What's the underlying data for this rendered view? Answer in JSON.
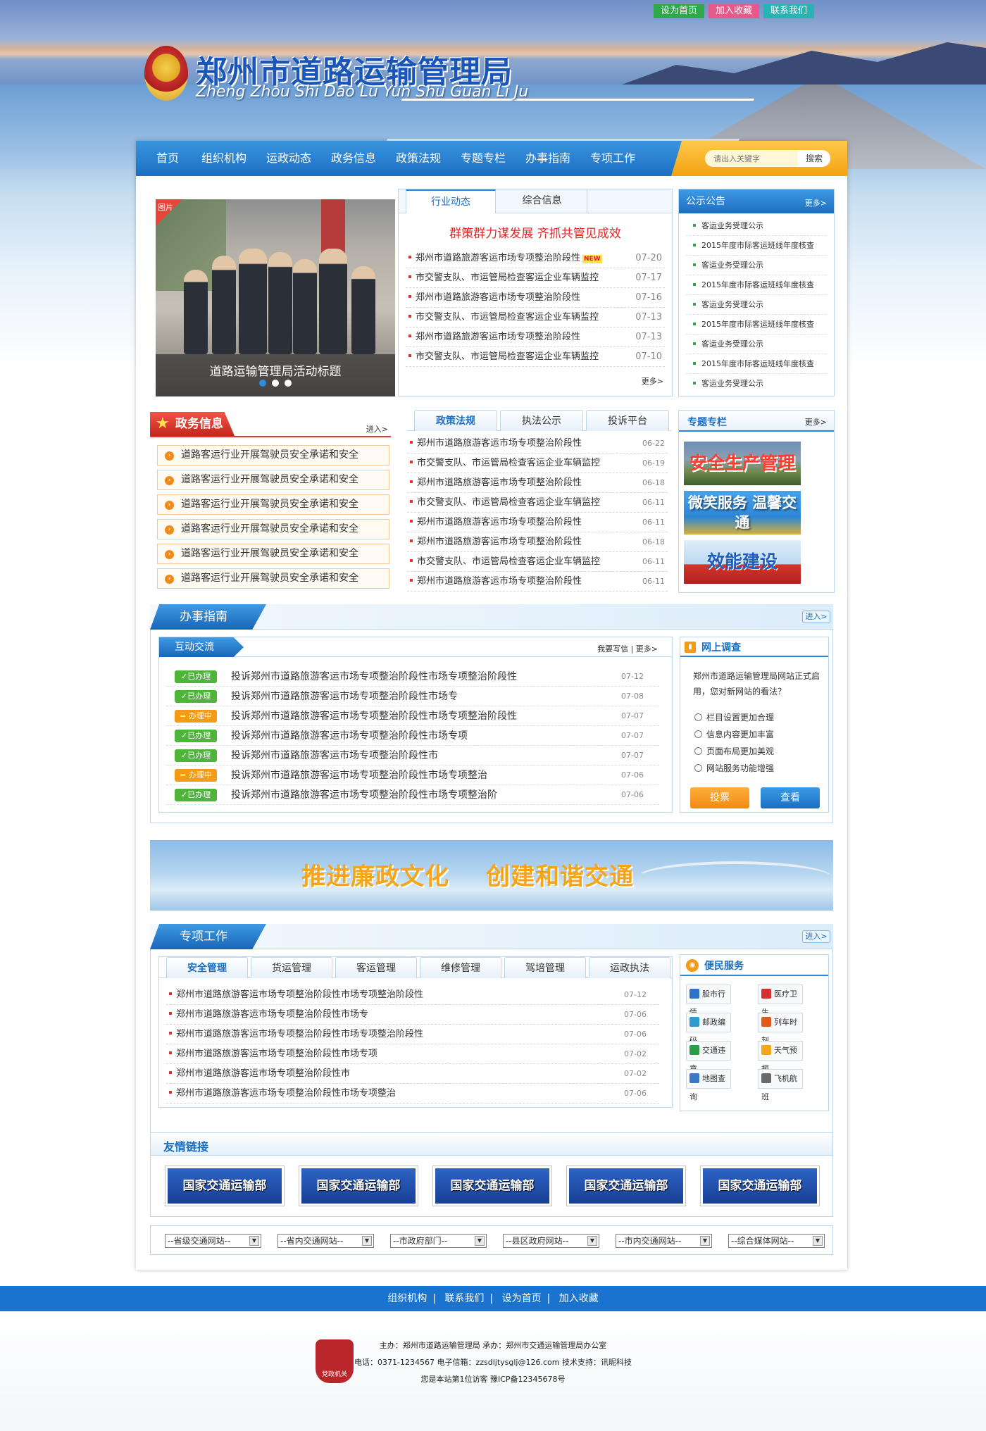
{
  "top_links": [
    "设为首页",
    "加入收藏",
    "联系我们"
  ],
  "site": {
    "title": "郑州市道路运输管理局",
    "subtitle": "Zheng Zhou Shi Dao Lu Yun Shu Guan Li Ju"
  },
  "nav": [
    "首页",
    "组织机构",
    "运政动态",
    "政务信息",
    "政策法规",
    "专题专栏",
    "办事指南",
    "专项工作"
  ],
  "search": {
    "placeholder": "请出入关键字",
    "button": "搜索"
  },
  "slider": {
    "badge": "图片",
    "caption": "道路运输管理局活动标题"
  },
  "news": {
    "tabs": [
      "行业动态",
      "综合信息"
    ],
    "headline": "群策群力谋发展 齐抓共管见成效",
    "new_tag": "NEW",
    "items": [
      {
        "title": "郑州市道路旅游客运市场专项整治阶段性",
        "date": "07-20"
      },
      {
        "title": "市交警支队、市运管局检查客运企业车辆监控",
        "date": "07-17"
      },
      {
        "title": "郑州市道路旅游客运市场专项整治阶段性",
        "date": "07-16"
      },
      {
        "title": "市交警支队、市运管局检查客运企业车辆监控",
        "date": "07-13"
      },
      {
        "title": "郑州市道路旅游客运市场专项整治阶段性",
        "date": "07-13"
      },
      {
        "title": "市交警支队、市运管局检查客运企业车辆监控",
        "date": "07-10"
      }
    ],
    "more": "更多>"
  },
  "notice": {
    "title": "公示公告",
    "more": "更多>",
    "items": [
      "客运业务受理公示",
      "2015年度市际客运班线年度核查",
      "客运业务受理公示",
      "2015年度市际客运班线年度核查",
      "客运业务受理公示",
      "2015年度市际客运班线年度核查",
      "客运业务受理公示",
      "2015年度市际客运班线年度核查",
      "客运业务受理公示"
    ]
  },
  "gov": {
    "title": "政务信息",
    "enter": "进入>",
    "items": [
      "道路客运行业开展驾驶员安全承诺和安全",
      "道路客运行业开展驾驶员安全承诺和安全",
      "道路客运行业开展驾驶员安全承诺和安全",
      "道路客运行业开展驾驶员安全承诺和安全",
      "道路客运行业开展驾驶员安全承诺和安全",
      "道路客运行业开展驾驶员安全承诺和安全"
    ]
  },
  "policy": {
    "tabs": [
      "政策法规",
      "执法公示",
      "投诉平台"
    ],
    "items": [
      {
        "title": "郑州市道路旅游客运市场专项整治阶段性",
        "date": "06-22"
      },
      {
        "title": "市交警支队、市运管局检查客运企业车辆监控",
        "date": "06-19"
      },
      {
        "title": "郑州市道路旅游客运市场专项整治阶段性",
        "date": "06-18"
      },
      {
        "title": "市交警支队、市运管局检查客运企业车辆监控",
        "date": "06-11"
      },
      {
        "title": "郑州市道路旅游客运市场专项整治阶段性",
        "date": "06-11"
      },
      {
        "title": "郑州市道路旅游客运市场专项整治阶段性",
        "date": "06-18"
      },
      {
        "title": "市交警支队、市运管局检查客运企业车辆监控",
        "date": "06-11"
      },
      {
        "title": "郑州市道路旅游客运市场专项整治阶段性",
        "date": "06-11"
      }
    ]
  },
  "topics": {
    "title": "专题专栏",
    "more": "更多>",
    "items": [
      "安全生产管理",
      "微笑服务 温馨交通",
      "效能建设"
    ]
  },
  "guide": {
    "title": "办事指南",
    "enter": "进入>"
  },
  "interact": {
    "title": "互动交流",
    "write": "我要写信",
    "more": "更多>",
    "items": [
      {
        "status": "已办理",
        "title": "投诉郑州市道路旅游客运市场专项整治阶段性市场专项整治阶段性",
        "date": "07-12"
      },
      {
        "status": "已办理",
        "title": "投诉郑州市道路旅游客运市场专项整治阶段性市场专",
        "date": "07-08"
      },
      {
        "status": "办理中",
        "title": "投诉郑州市道路旅游客运市场专项整治阶段性市场专项整治阶段性",
        "date": "07-07"
      },
      {
        "status": "已办理",
        "title": "投诉郑州市道路旅游客运市场专项整治阶段性市场专项",
        "date": "07-07"
      },
      {
        "status": "已办理",
        "title": "投诉郑州市道路旅游客运市场专项整治阶段性市",
        "date": "07-07"
      },
      {
        "status": "办理中",
        "title": "投诉郑州市道路旅游客运市场专项整治阶段性市场专项整治",
        "date": "07-06"
      },
      {
        "status": "已办理",
        "title": "投诉郑州市道路旅游客运市场专项整治阶段性市场专项整治阶",
        "date": "07-06"
      }
    ]
  },
  "survey": {
    "title": "网上调查",
    "question": "郑州市道路运输管理局网站正式启用，您对新网站的看法？",
    "options": [
      "栏目设置更加合理",
      "信息内容更加丰富",
      "页面布局更加美观",
      "网站服务功能增强"
    ],
    "vote": "投票",
    "view": "查看"
  },
  "promo": {
    "left": "推进廉政文化",
    "right": "创建和谐交通"
  },
  "special": {
    "title": "专项工作",
    "enter": "进入>",
    "tabs": [
      "安全管理",
      "货运管理",
      "客运管理",
      "维修管理",
      "驾培管理",
      "运政执法"
    ],
    "items": [
      {
        "title": "郑州市道路旅游客运市场专项整治阶段性市场专项整治阶段性",
        "date": "07-12"
      },
      {
        "title": "郑州市道路旅游客运市场专项整治阶段性市场专",
        "date": "07-06"
      },
      {
        "title": "郑州市道路旅游客运市场专项整治阶段性市场专项整治阶段性",
        "date": "07-06"
      },
      {
        "title": "郑州市道路旅游客运市场专项整治阶段性市场专项",
        "date": "07-02"
      },
      {
        "title": "郑州市道路旅游客运市场专项整治阶段性市",
        "date": "07-02"
      },
      {
        "title": "郑州市道路旅游客运市场专项整治阶段性市场专项整治",
        "date": "07-06"
      }
    ]
  },
  "service": {
    "title": "便民服务",
    "items": [
      {
        "label": "股市行情",
        "icon": "chart-icon",
        "color": "#2e72c9"
      },
      {
        "label": "医疗卫生",
        "icon": "medical-cross-icon",
        "color": "#d62f2f"
      },
      {
        "label": "邮政编码",
        "icon": "mail-icon",
        "color": "#2e9ad3"
      },
      {
        "label": "列车时刻",
        "icon": "train-icon",
        "color": "#e05a1a"
      },
      {
        "label": "交通违章",
        "icon": "traffic-icon",
        "color": "#2a9d4a"
      },
      {
        "label": "天气预报",
        "icon": "weather-sun-icon",
        "color": "#f0a818"
      },
      {
        "label": "地图查询",
        "icon": "map-search-icon",
        "color": "#3a78c6"
      },
      {
        "label": "飞机航班",
        "icon": "plane-icon",
        "color": "#6a6a6a"
      }
    ]
  },
  "links": {
    "title": "友情链接",
    "items": [
      "国家交通运输部",
      "国家交通运输部",
      "国家交通运输部",
      "国家交通运输部",
      "国家交通运输部"
    ]
  },
  "selects": [
    "--省级交通网站--",
    "--省内交通网站--",
    "--市政府部门--",
    "--县区政府网站--",
    "--市内交通网站--",
    "--综合媒体网站--"
  ],
  "footer": {
    "links": [
      "组织机构",
      "联系我们",
      "设为首页",
      "加入收藏"
    ],
    "badge": "党政机关",
    "line1": "主办：郑州市道路运输管理局  承办：郑州市交通运输管理局办公室",
    "line2": "电话：0371-1234567  电子信箱：zzsdljtysglj@126.com  技术支持：讯昵科技",
    "line3": "您是本站第1位访客  豫ICP备12345678号"
  }
}
